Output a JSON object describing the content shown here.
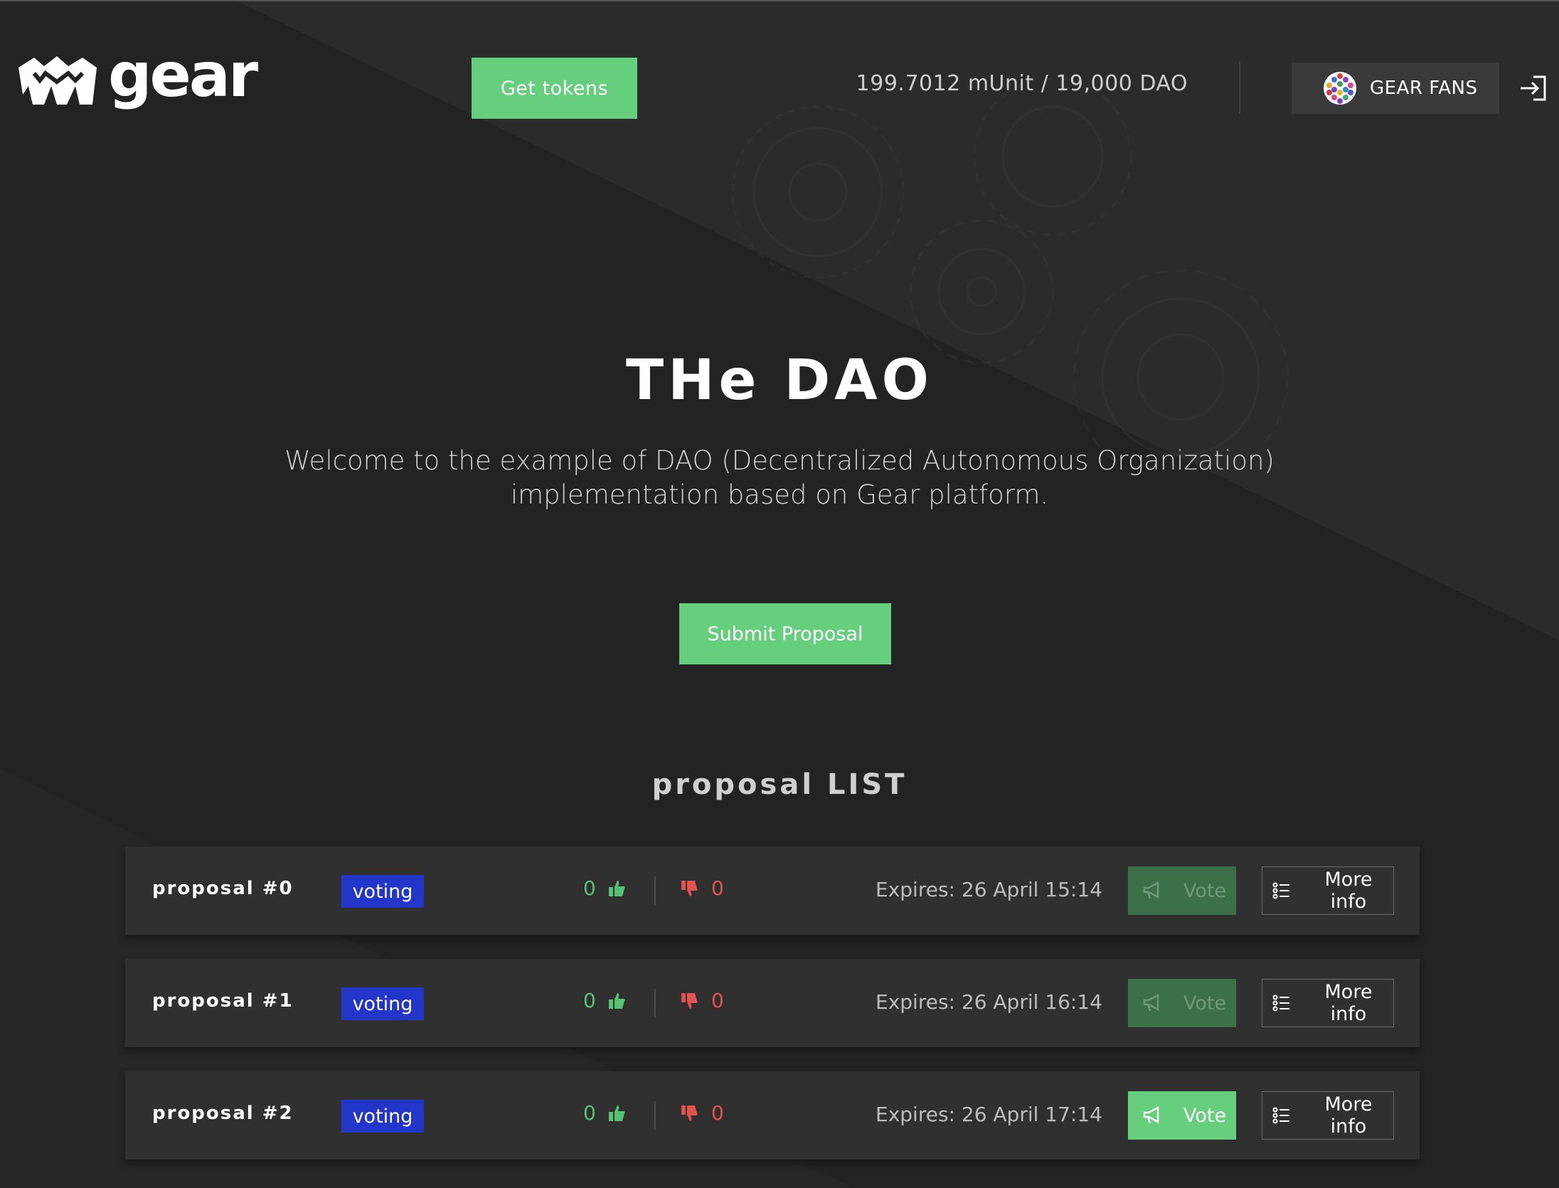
{
  "header": {
    "logo_text": "gear",
    "get_tokens_label": "Get tokens",
    "balance": "199.7012 mUnit / 19,000 DAO",
    "account_name": "GEAR FANS"
  },
  "hero": {
    "title": "THe DAO",
    "subtitle": "Welcome to the example of DAO (Decentralized Autonomous Organization) implementation based on Gear platform.",
    "submit_label": "Submit Proposal"
  },
  "proposal_list": {
    "title": "proposal LIST",
    "vote_label": "Vote",
    "more_info_label": "More info",
    "items": [
      {
        "name": "proposal #0",
        "status": "voting",
        "yes": "0",
        "no": "0",
        "expires": "Expires: 26 April 15:14",
        "vote_enabled": false
      },
      {
        "name": "proposal #1",
        "status": "voting",
        "yes": "0",
        "no": "0",
        "expires": "Expires: 26 April 16:14",
        "vote_enabled": false
      },
      {
        "name": "proposal #2",
        "status": "voting",
        "yes": "0",
        "no": "0",
        "expires": "Expires: 26 April 17:14",
        "vote_enabled": true
      }
    ]
  },
  "colors": {
    "accent_green": "#65cf7e",
    "badge_blue": "#2236c9",
    "like_green": "#55c274",
    "dislike_red": "#e0534f",
    "background": "#232323"
  },
  "icons": {
    "logo": "gear-logo-icon",
    "avatar": "polkadot-avatar-icon",
    "logout": "logout-icon",
    "like": "thumbs-up-icon",
    "dislike": "thumbs-down-icon",
    "vote": "megaphone-icon",
    "more": "list-icon"
  }
}
